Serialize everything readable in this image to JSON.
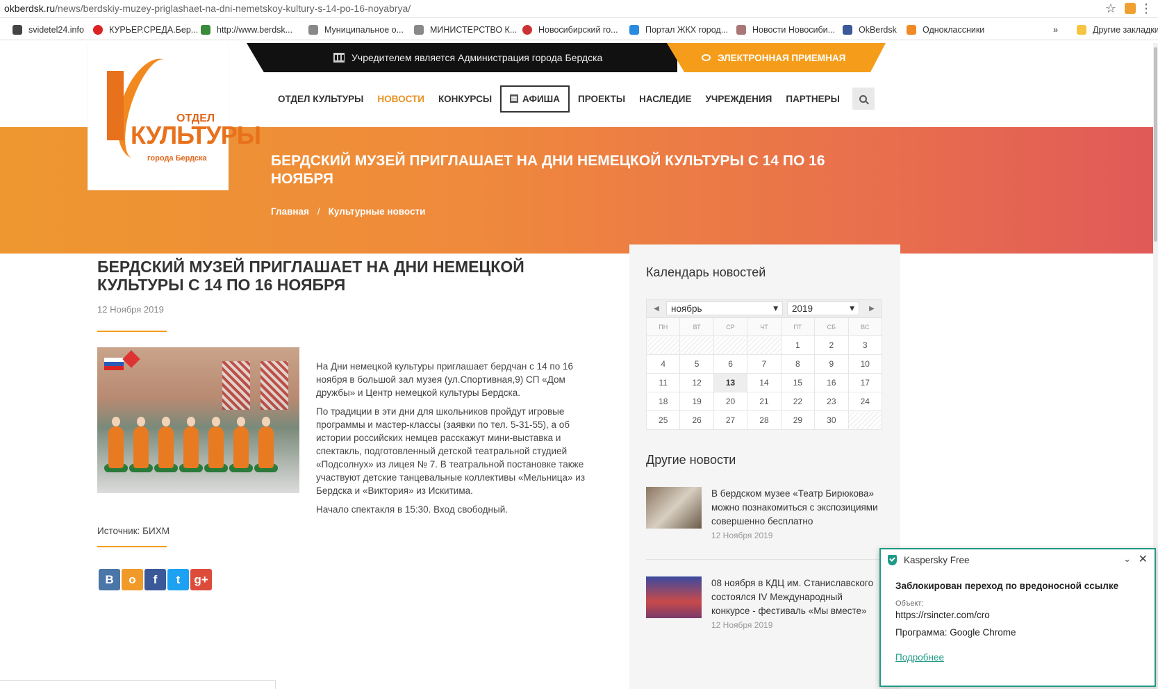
{
  "browser": {
    "url_domain": "okberdsk.ru",
    "url_path": "/news/berdskiy-muzey-priglashaet-na-dni-nemetskoy-kultury-s-14-po-16-noyabrya/",
    "bookmarks": [
      {
        "label": "svidetel24.info",
        "color": "#444"
      },
      {
        "label": "КУРЬЕР.СРЕДА.Бер...",
        "color": "#d22"
      },
      {
        "label": "http://www.berdsk...",
        "color": "#3a8a3a"
      },
      {
        "label": "Муниципальное о...",
        "color": "#888"
      },
      {
        "label": "МИНИСТЕРСТВО К...",
        "color": "#888"
      },
      {
        "label": "Новосибирский го...",
        "color": "#c33"
      },
      {
        "label": "Портал ЖКХ город...",
        "color": "#2a8ae0"
      },
      {
        "label": "Новости Новосиби...",
        "color": "#a77"
      },
      {
        "label": "OkBerdsk",
        "color": "#3b5998"
      },
      {
        "label": "Одноклассники",
        "color": "#f08a24"
      }
    ],
    "more_label": "»",
    "other_bookmarks": "Другие закладки"
  },
  "site": {
    "founder_text": "Учредителем является Администрация города Бердска",
    "reception_label": "ЭЛЕКТРОННАЯ ПРИЕМНАЯ",
    "logo": {
      "top": "ОТДЕЛ",
      "main": "КУЛЬТУРЫ",
      "sub": "города Бердска"
    },
    "nav": [
      "ОТДЕЛ КУЛЬТУРЫ",
      "НОВОСТИ",
      "КОНКУРСЫ",
      "АФИША",
      "ПРОЕКТЫ",
      "НАСЛЕДИЕ",
      "УЧРЕЖДЕНИЯ",
      "ПАРТНЕРЫ"
    ],
    "banner_title": "БЕРДСКИЙ МУЗЕЙ ПРИГЛАШАЕТ НА ДНИ НЕМЕЦКОЙ КУЛЬТУРЫ С 14 ПО 16 НОЯБРЯ",
    "breadcrumb": {
      "home": "Главная",
      "sep": "/",
      "section": "Культурные новости"
    }
  },
  "article": {
    "title": "БЕРДСКИЙ МУЗЕЙ ПРИГЛАШАЕТ НА ДНИ НЕМЕЦКОЙ КУЛЬТУРЫ С 14 ПО 16 НОЯБРЯ",
    "date": "12 Ноября 2019",
    "p1": "На Дни немецкой культуры приглашает бердчан с 14 по 16 ноября в большой зал музея (ул.Спортивная,9) СП «Дом дружбы» и Центр немецкой культуры Бердска.",
    "p2": "По традиции в эти дни для школьников пройдут игровые программы и мастер-классы (заявки по тел. 5-31-55), а об истории российских немцев расскажут мини-выставка и спектакль, подготовленный детской театральной студией «Подсолнух» из лицея № 7. В театральной постановке также участвуют детские танцевальные коллективы «Мельница» из Бердска и «Виктория» из Искитима.",
    "p3": "Начало спектакля в 15:30. Вход свободный.",
    "source": "Источник: БИХМ",
    "share": [
      {
        "label": "В",
        "color": "#4a76a8"
      },
      {
        "label": "о",
        "color": "#f09a2a"
      },
      {
        "label": "f",
        "color": "#3b5998"
      },
      {
        "label": "t",
        "color": "#1da1f2"
      },
      {
        "label": "g+",
        "color": "#dd4b39"
      }
    ]
  },
  "sidebar": {
    "calendar_title": "Календарь новостей",
    "month": "ноябрь",
    "year": "2019",
    "weekdays": [
      "ПН",
      "ВТ",
      "СР",
      "ЧТ",
      "ПТ",
      "СБ",
      "ВС"
    ],
    "weeks": [
      [
        "",
        "",
        "",
        "",
        "1",
        "2",
        "3"
      ],
      [
        "4",
        "5",
        "6",
        "7",
        "8",
        "9",
        "10"
      ],
      [
        "11",
        "12",
        "13",
        "14",
        "15",
        "16",
        "17"
      ],
      [
        "18",
        "19",
        "20",
        "21",
        "22",
        "23",
        "24"
      ],
      [
        "25",
        "26",
        "27",
        "28",
        "29",
        "30",
        ""
      ]
    ],
    "today": "13",
    "other_news_title": "Другие новости",
    "news": [
      {
        "text": "В бердском музее «Театр Бирюкова» можно познакомиться с экспозициями совершенно бесплатно",
        "date": "12 Ноября 2019"
      },
      {
        "text": "08 ноября в КДЦ им. Станиславского состоялся IV Международный конкурсе - фестиваль «Мы вместе»",
        "date": "12 Ноября 2019"
      }
    ]
  },
  "kaspersky": {
    "app": "Kaspersky Free",
    "title": "Заблокирован переход по вредоносной ссылке",
    "object_label": "Объект:",
    "object": "https://rsincter.com/cro",
    "program": "Программа: Google Chrome",
    "more": "Подробнее"
  }
}
